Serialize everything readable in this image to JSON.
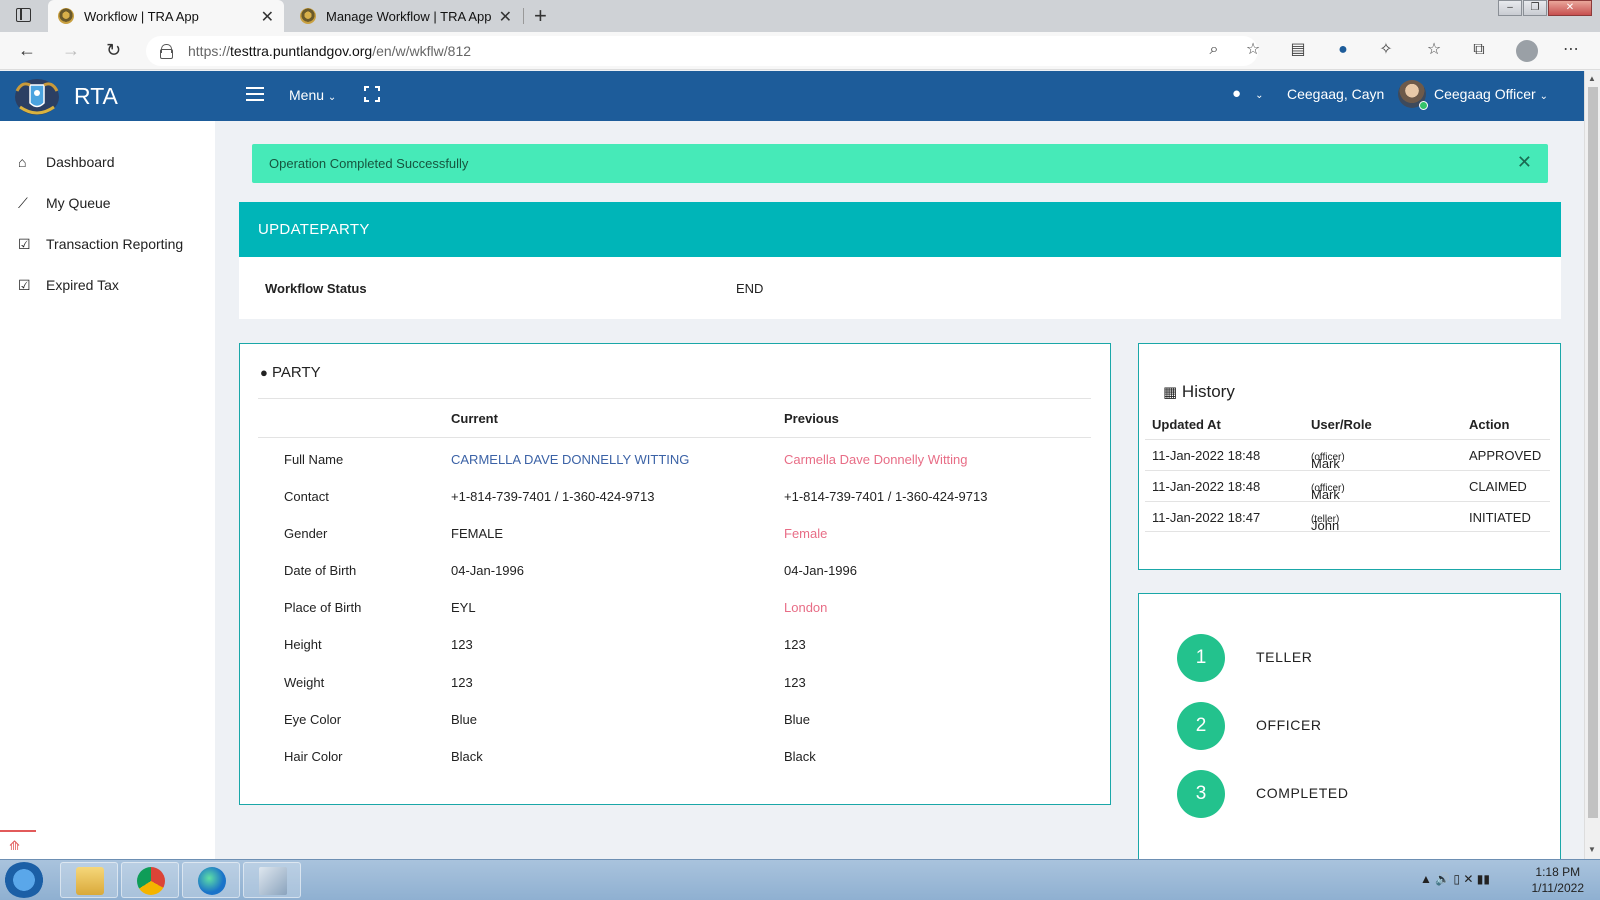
{
  "browser": {
    "tabs": [
      {
        "title": "Workflow | TRA App",
        "active": true
      },
      {
        "title": "Manage Workflow | TRA App",
        "active": false
      }
    ],
    "url_prefix": "https://",
    "url_domain": "testtra.puntlandgov.org",
    "url_path": "/en/w/wkflw/812"
  },
  "header": {
    "brand": "RTA",
    "menu_label": "Menu",
    "user_short": "Ceegaag, Cayn",
    "user_full": "Ceegaag Officer"
  },
  "sidebar": {
    "items": [
      {
        "label": "Dashboard",
        "icon": "home-icon"
      },
      {
        "label": "My Queue",
        "icon": "trend-icon"
      },
      {
        "label": "Transaction Reporting",
        "icon": "checkbox-icon"
      },
      {
        "label": "Expired Tax",
        "icon": "checkbox-icon"
      }
    ]
  },
  "alert": {
    "message": "Operation Completed Successfully"
  },
  "workflow": {
    "title": "UPDATEPARTY",
    "status_label": "Workflow Status",
    "status_value": "END"
  },
  "party": {
    "title": "PARTY",
    "col_current": "Current",
    "col_previous": "Previous",
    "rows": [
      {
        "label": "Full Name",
        "current": "CARMELLA DAVE DONNELLY WITTING",
        "previous": "Carmella Dave Donnelly Witting"
      },
      {
        "label": "Contact",
        "current": "+1-814-739-7401 / 1-360-424-9713",
        "previous": "+1-814-739-7401 / 1-360-424-9713"
      },
      {
        "label": "Gender",
        "current": "FEMALE",
        "previous": "Female"
      },
      {
        "label": "Date of Birth",
        "current": "04-Jan-1996",
        "previous": "04-Jan-1996"
      },
      {
        "label": "Place of Birth",
        "current": "EYL",
        "previous": "London"
      },
      {
        "label": "Height",
        "current": "123",
        "previous": "123"
      },
      {
        "label": "Weight",
        "current": "123",
        "previous": "123"
      },
      {
        "label": "Eye Color",
        "current": "Blue",
        "previous": "Blue"
      },
      {
        "label": "Hair Color",
        "current": "Black",
        "previous": "Black"
      }
    ]
  },
  "history": {
    "title": "History",
    "headers": [
      "Updated At",
      "User/Role",
      "Action"
    ],
    "rows": [
      {
        "updated_at": "11-Jan-2022 18:48",
        "user": "Mark",
        "role": "(officer)",
        "action": "APPROVED"
      },
      {
        "updated_at": "11-Jan-2022 18:48",
        "user": "Mark",
        "role": "(officer)",
        "action": "CLAIMED"
      },
      {
        "updated_at": "11-Jan-2022 18:47",
        "user": "John",
        "role": "(teller)",
        "action": "INITIATED"
      }
    ]
  },
  "steps": [
    {
      "number": "1",
      "label": "TELLER"
    },
    {
      "number": "2",
      "label": "OFFICER"
    },
    {
      "number": "3",
      "label": "COMPLETED"
    }
  ],
  "taskbar": {
    "time": "1:18 PM",
    "date": "1/11/2022"
  },
  "colors": {
    "header_bg": "#1d5c9a",
    "alert_bg": "#46eab8",
    "banner_bg": "#00b5b8",
    "step_circle": "#23c28d",
    "changed_current": "#3b62a6",
    "changed_previous": "#e86d86"
  }
}
